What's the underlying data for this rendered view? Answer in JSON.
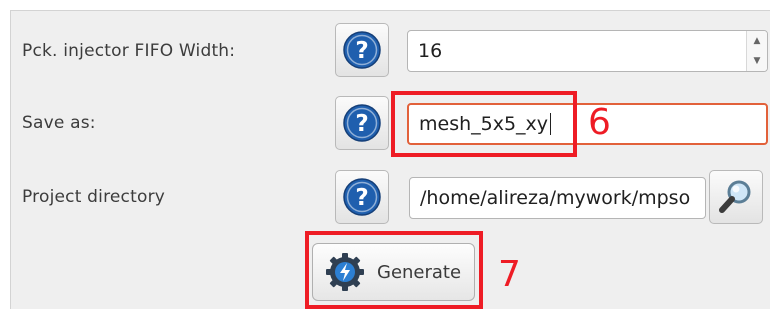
{
  "form": {
    "fifo_width": {
      "label": "Pck. injector FIFO Width:",
      "value": "16"
    },
    "save_as": {
      "label": "Save as:",
      "value": "mesh_5x5_xy"
    },
    "project_directory": {
      "label": "Project directory",
      "value": "/home/alireza/mywork/mpso"
    }
  },
  "generate_button": {
    "label": "Generate",
    "icon": "power-gear-icon"
  },
  "annotations": {
    "step6": "6",
    "step7": "7"
  },
  "colors": {
    "annotation": "#ee1c25",
    "focus_border": "#e2613a",
    "help_blue": "#1f5fae"
  }
}
